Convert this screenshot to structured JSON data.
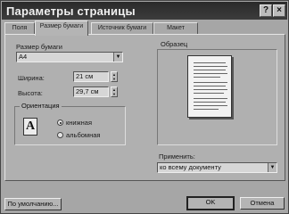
{
  "window": {
    "title": "Параметры страницы"
  },
  "titlebar": {
    "help_label": "?",
    "close_label": "×"
  },
  "tabs": [
    {
      "label": "Поля",
      "active": false
    },
    {
      "label": "Размер бумаги",
      "active": true
    },
    {
      "label": "Источник бумаги",
      "active": false
    },
    {
      "label": "Макет",
      "active": false
    }
  ],
  "paper_size": {
    "label": "Размер бумаги",
    "value": "A4"
  },
  "width": {
    "label": "Ширина:",
    "value": "21 см"
  },
  "height": {
    "label": "Высота:",
    "value": "29,7 см"
  },
  "orientation": {
    "label": "Ориентация",
    "icon_glyph": "A",
    "options": [
      {
        "label": "книжная",
        "checked": true
      },
      {
        "label": "альбомная",
        "checked": false
      }
    ]
  },
  "preview": {
    "label": "Образец"
  },
  "apply": {
    "label": "Применить:",
    "value": "ко всему документу"
  },
  "buttons": {
    "default_label": "По умолчанию...",
    "ok_label": "OK",
    "cancel_label": "Отмена"
  }
}
